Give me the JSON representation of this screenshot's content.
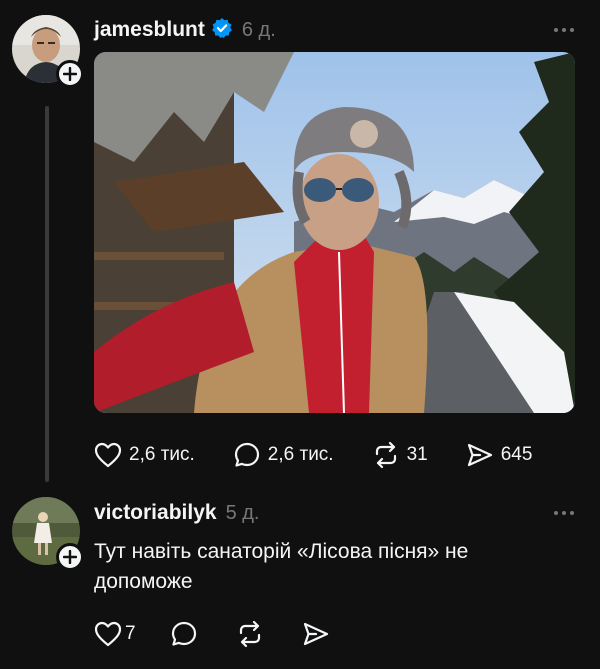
{
  "post": {
    "username": "jamesblunt",
    "time": "6 д.",
    "likes": "2,6 тис.",
    "comments": "2,6 тис.",
    "reposts": "31",
    "shares": "645"
  },
  "reply": {
    "username": "victoriabilyk",
    "time": "5 д.",
    "text": "Тут навіть санаторій «Лісова пісня» не допоможе",
    "likes": "7"
  },
  "colors": {
    "background": "#101010",
    "text_primary": "#f3f5f7",
    "text_secondary": "#777777",
    "verified": "#0095f6",
    "thread_line": "#3a3a3a"
  },
  "icons": [
    "follow-plus-icon",
    "verified-icon",
    "more-icon",
    "heart-icon",
    "comment-icon",
    "repost-icon",
    "share-icon"
  ]
}
